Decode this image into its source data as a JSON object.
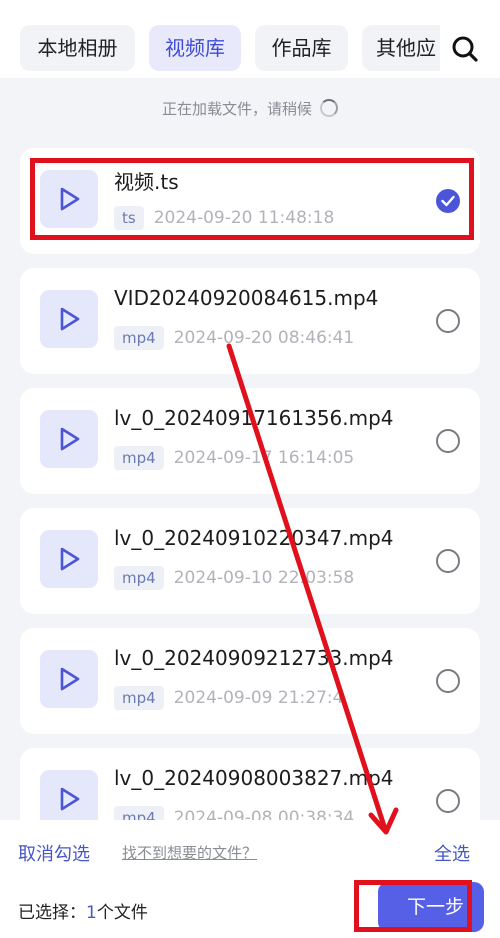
{
  "tabs": [
    {
      "label": "本地相册",
      "active": false
    },
    {
      "label": "视频库",
      "active": true
    },
    {
      "label": "作品库",
      "active": false
    },
    {
      "label": "其他应",
      "active": false
    }
  ],
  "search_icon": "search-icon",
  "loading_text": "正在加载文件，请稍候",
  "files": [
    {
      "name": "视频.ts",
      "ext": "ts",
      "date": "2024-09-20 11:48:18",
      "selected": true
    },
    {
      "name": "VID20240920084615.mp4",
      "ext": "mp4",
      "date": "2024-09-20 08:46:41",
      "selected": false
    },
    {
      "name": "lv_0_20240917161356.mp4",
      "ext": "mp4",
      "date": "2024-09-17 16:14:05",
      "selected": false
    },
    {
      "name": "lv_0_20240910220347.mp4",
      "ext": "mp4",
      "date": "2024-09-10 22:03:58",
      "selected": false
    },
    {
      "name": "lv_0_20240909212733.mp4",
      "ext": "mp4",
      "date": "2024-09-09 21:27:4",
      "selected": false
    },
    {
      "name": "lv_0_20240908003827.mp4",
      "ext": "mp4",
      "date": "2024-09-08 00:38:34",
      "selected": false
    }
  ],
  "bottom": {
    "deselect_label": "取消勾选",
    "not_found_label": "找不到想要的文件？",
    "select_all_label": "全选",
    "selected_prefix": "已选择：",
    "selected_count": "1",
    "selected_suffix": "个文件",
    "next_label": "下一步"
  },
  "colors": {
    "accent": "#4a55d8",
    "annotation": "#e0101c"
  }
}
